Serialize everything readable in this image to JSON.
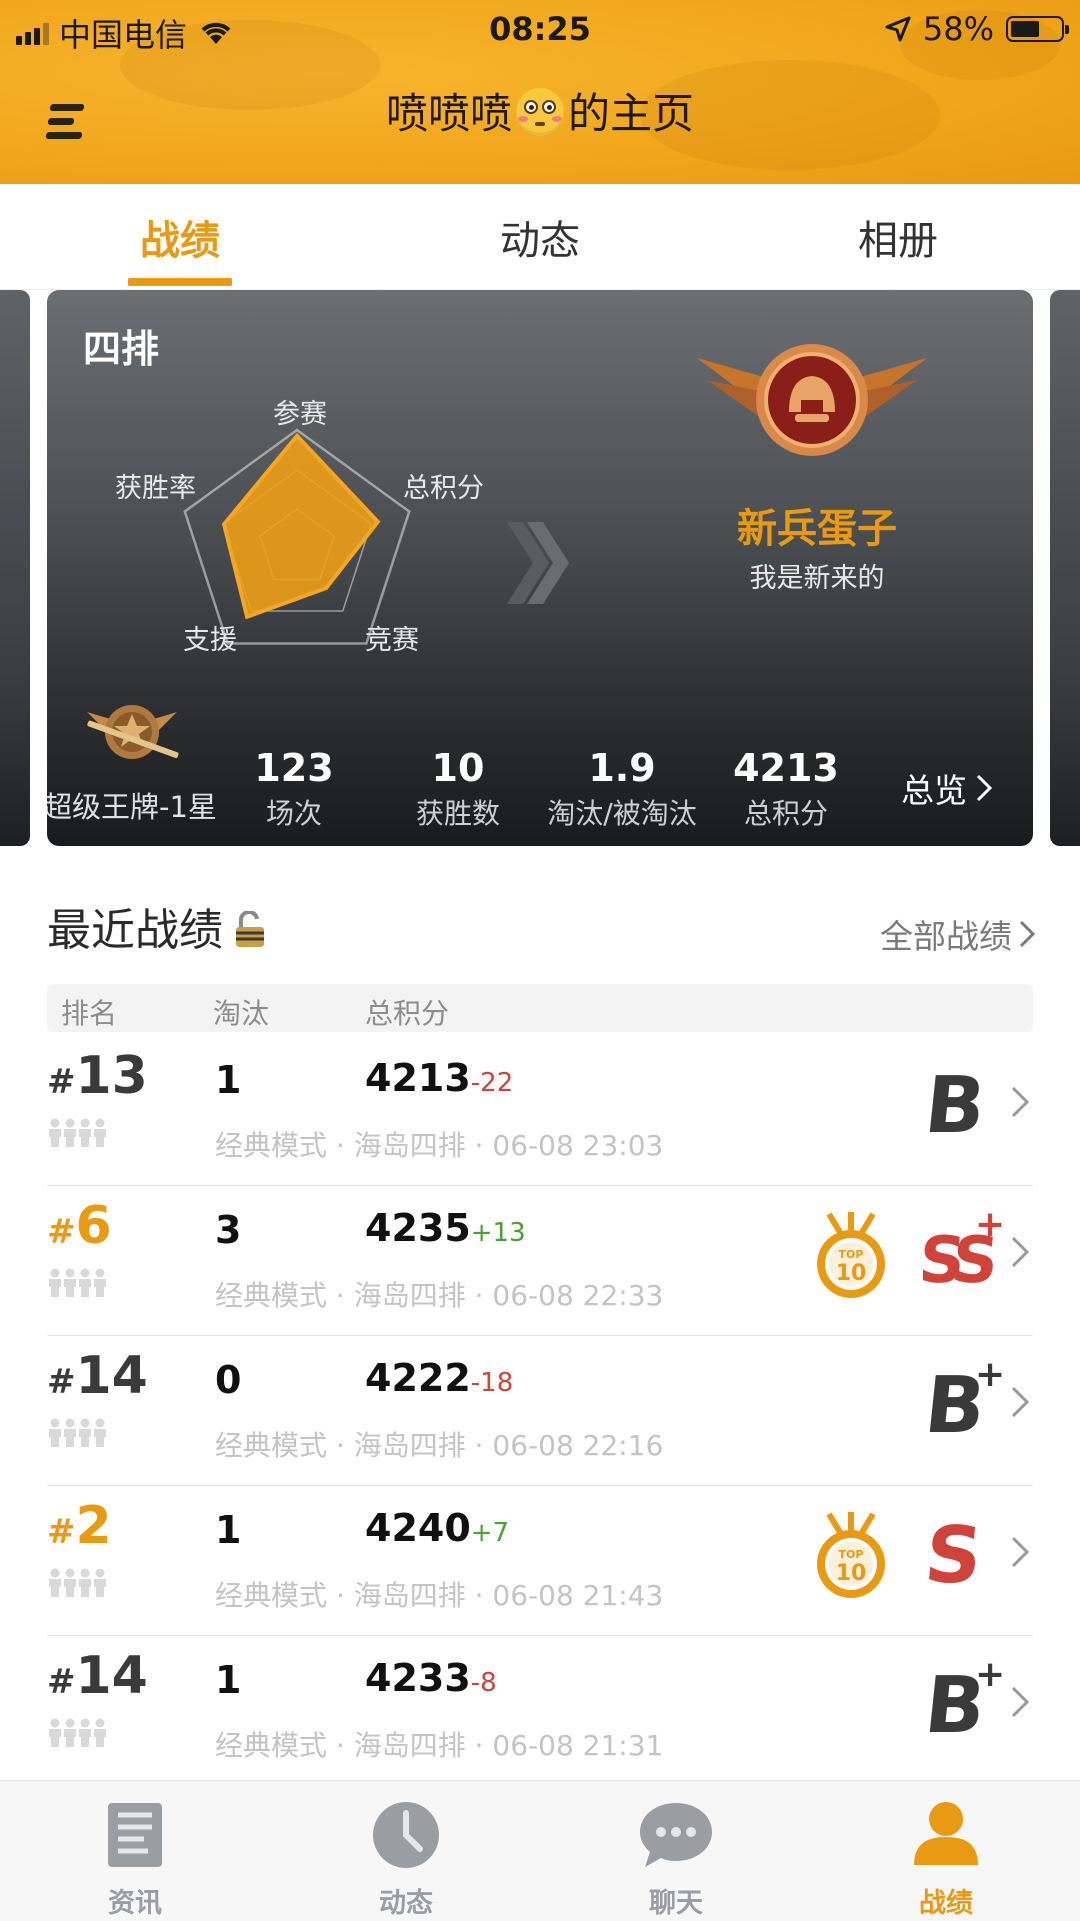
{
  "status_bar": {
    "carrier": "中国电信",
    "time": "08:25",
    "battery": "58%",
    "battery_level": 0.58
  },
  "header": {
    "title_prefix": "喷喷喷",
    "title_suffix": "的主页",
    "emoji": "flushed-face-emoji"
  },
  "tabs": [
    {
      "label": "战绩",
      "active": true
    },
    {
      "label": "动态",
      "active": false
    },
    {
      "label": "相册",
      "active": false
    }
  ],
  "stats_card": {
    "mode": "四排",
    "radar": {
      "labels": {
        "top": "参赛",
        "right": "总积分",
        "bottom_right": "竞赛",
        "bottom_left": "支援",
        "left": "获胜率"
      },
      "values": {
        "top": 0.95,
        "right": 0.72,
        "bottom_right": 0.42,
        "bottom_left": 0.72,
        "left": 0.65
      }
    },
    "rank_name": "新兵蛋子",
    "rank_desc": "我是新来的",
    "tier": "超级王牌-1星",
    "stats": [
      {
        "value": "123",
        "label": "场次"
      },
      {
        "value": "10",
        "label": "获胜数"
      },
      {
        "value": "1.9",
        "label": "淘汰/被淘汰"
      },
      {
        "value": "4213",
        "label": "总积分"
      }
    ],
    "overview_label": "总览"
  },
  "recent": {
    "title": "最近战绩",
    "all_link": "全部战绩",
    "columns": [
      "排名",
      "淘汰",
      "总积分"
    ],
    "rows": [
      {
        "rank": "13",
        "kills": "1",
        "score": "4213",
        "delta": "-22",
        "delta_sign": "neg",
        "meta": "经典模式 · 海岛四排 · 06-08 23:03",
        "top10": false,
        "grade": "B"
      },
      {
        "rank": "6",
        "kills": "3",
        "score": "4235",
        "delta": "+13",
        "delta_sign": "pos",
        "meta": "经典模式 · 海岛四排 · 06-08 22:33",
        "top10": true,
        "grade": "SS+"
      },
      {
        "rank": "14",
        "kills": "0",
        "score": "4222",
        "delta": "-18",
        "delta_sign": "neg",
        "meta": "经典模式 · 海岛四排 · 06-08 22:16",
        "top10": false,
        "grade": "B+"
      },
      {
        "rank": "2",
        "kills": "1",
        "score": "4240",
        "delta": "+7",
        "delta_sign": "pos",
        "meta": "经典模式 · 海岛四排 · 06-08 21:43",
        "top10": true,
        "grade": "S"
      },
      {
        "rank": "14",
        "kills": "1",
        "score": "4233",
        "delta": "-8",
        "delta_sign": "neg",
        "meta": "经典模式 · 海岛四排 · 06-08 21:31",
        "top10": false,
        "grade": "B+"
      }
    ]
  },
  "bottom_nav": [
    {
      "label": "资讯",
      "icon": "news-icon",
      "active": false
    },
    {
      "label": "动态",
      "icon": "clock-icon",
      "active": false
    },
    {
      "label": "聊天",
      "icon": "chat-bubble-icon",
      "active": false
    },
    {
      "label": "战绩",
      "icon": "profile-icon",
      "active": true
    }
  ],
  "colors": {
    "accent": "#e99a13",
    "header": "#f1a71c",
    "negative": "#d0433a",
    "positive": "#4c9f32",
    "grade_red": "#d0433a",
    "grade_dark": "#3a3a3a"
  }
}
